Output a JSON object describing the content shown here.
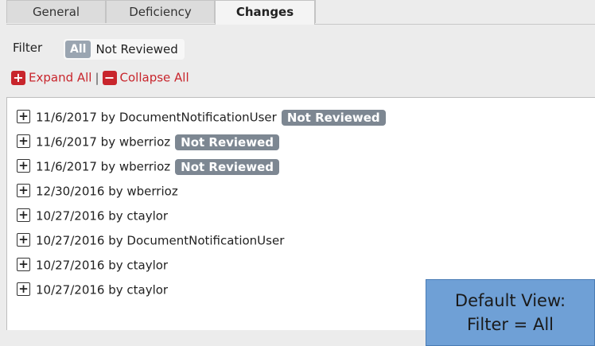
{
  "tabs": [
    {
      "label": "General"
    },
    {
      "label": "Deficiency"
    },
    {
      "label": "Changes"
    }
  ],
  "filter": {
    "label": "Filter",
    "options": [
      "All",
      "Not Reviewed"
    ],
    "selected": "All"
  },
  "actions": {
    "expand_label": "Expand All",
    "separator": "|",
    "collapse_label": "Collapse All"
  },
  "changes": [
    {
      "text": "11/6/2017 by DocumentNotificationUser",
      "badge": "Not Reviewed"
    },
    {
      "text": "11/6/2017 by wberrioz",
      "badge": "Not Reviewed"
    },
    {
      "text": "11/6/2017 by wberrioz",
      "badge": "Not Reviewed"
    },
    {
      "text": "12/30/2016 by wberrioz",
      "badge": ""
    },
    {
      "text": "10/27/2016 by ctaylor",
      "badge": ""
    },
    {
      "text": "10/27/2016 by DocumentNotificationUser",
      "badge": ""
    },
    {
      "text": "10/27/2016 by ctaylor",
      "badge": ""
    },
    {
      "text": "10/27/2016 by ctaylor",
      "badge": ""
    }
  ],
  "callout": {
    "line1": "Default View:",
    "line2": "Filter = All"
  },
  "colors": {
    "accent_red": "#c8252c",
    "badge_gray": "#7d8792",
    "callout_blue": "#6fa0d6"
  },
  "icons": {
    "expand": "plus-square-icon",
    "collapse": "minus-square-icon",
    "row_toggle": "plus-box-icon"
  }
}
